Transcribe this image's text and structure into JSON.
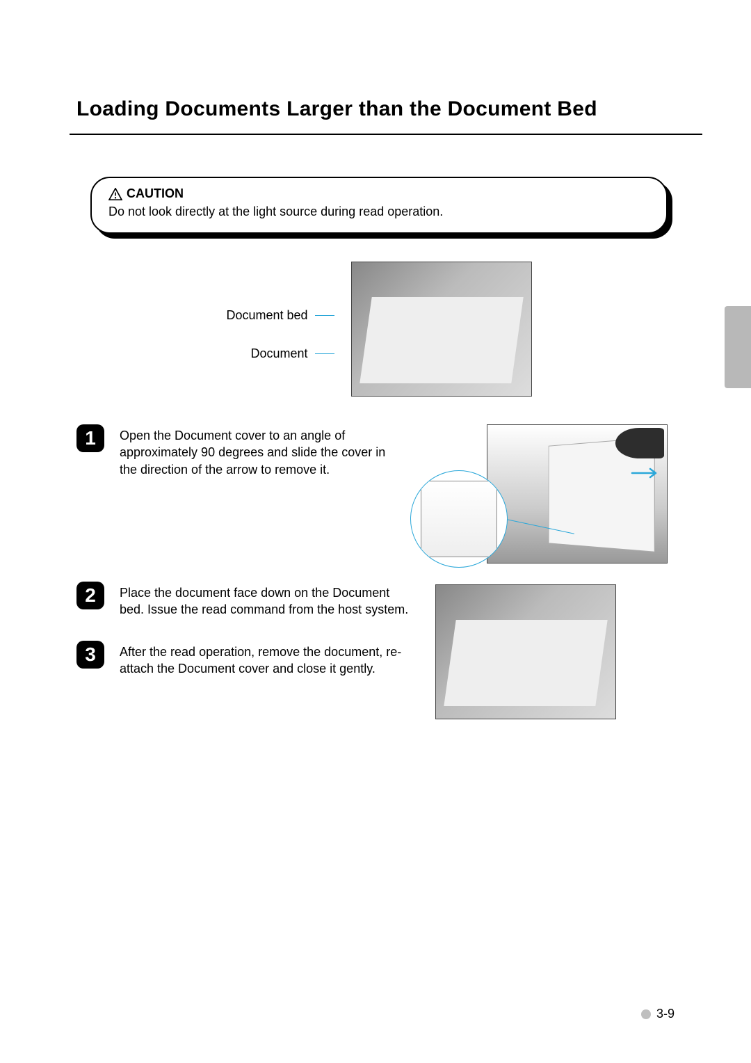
{
  "title": "Loading Documents Larger than the Document Bed",
  "caution": {
    "heading": "CAUTION",
    "text": "Do not look directly at the light source during read operation."
  },
  "overview_labels": {
    "document_bed": "Document bed",
    "document": "Document"
  },
  "steps": [
    {
      "number": "1",
      "text": "Open the Document cover to an angle of approximately 90 degrees and slide the cover in the direction of the arrow to remove it."
    },
    {
      "number": "2",
      "text": "Place the document face down on the Document bed. Issue the read command from the host system."
    },
    {
      "number": "3",
      "text": "After the read operation, remove the document, re-attach the Document cover and close it gently."
    }
  ],
  "page_number": "3-9"
}
